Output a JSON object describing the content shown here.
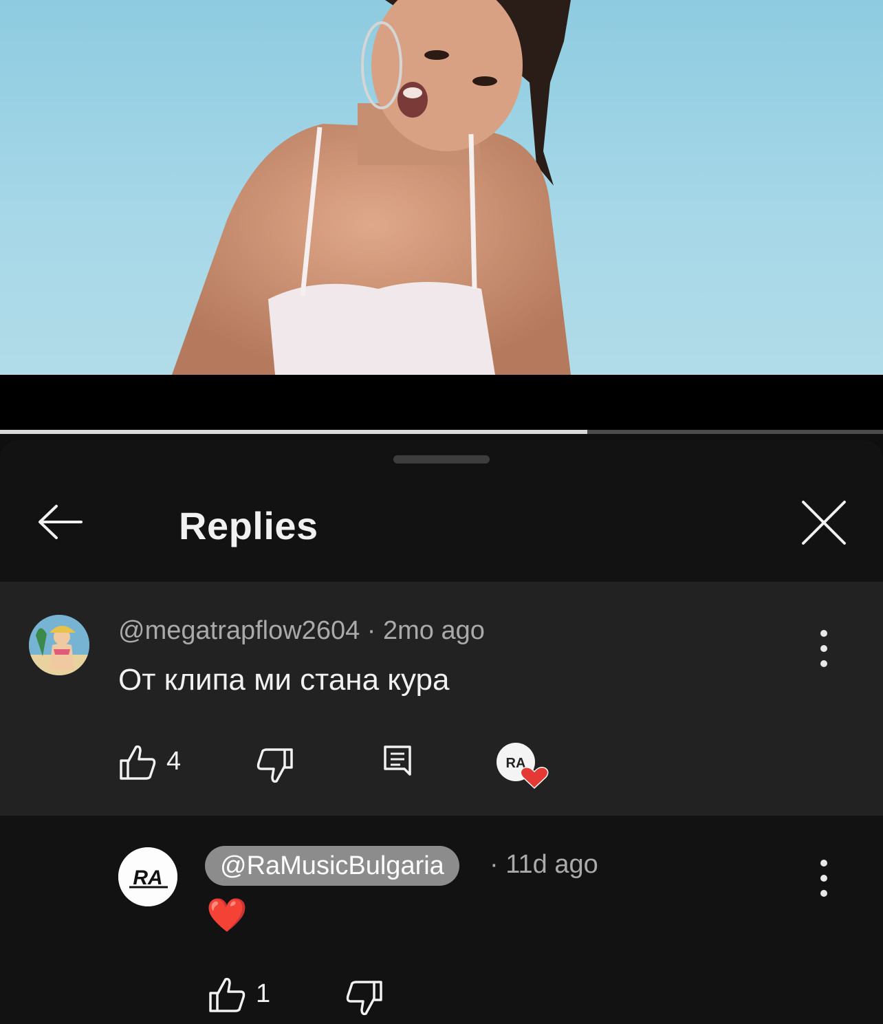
{
  "video": {
    "description_icon": "video-frame-image",
    "progress_fraction": 0.665
  },
  "header": {
    "title": "Replies",
    "back_icon": "arrow-left-icon",
    "close_icon": "close-icon"
  },
  "comment": {
    "author": "@megatrapflow2604",
    "separator": "·",
    "time": "2mo ago",
    "text": "От клипа ми стана кура",
    "like_count": "4",
    "hearted_by": "RA"
  },
  "reply": {
    "author": "@RaMusicBulgaria",
    "separator": "·",
    "time": "11d ago",
    "text": "❤️",
    "avatar_text": "RA",
    "like_count": "1"
  },
  "colors": {
    "sheet_bg": "#121212",
    "comment_bg": "#222222",
    "heart": "#e53935",
    "video_bg": "#a7d8e8"
  }
}
